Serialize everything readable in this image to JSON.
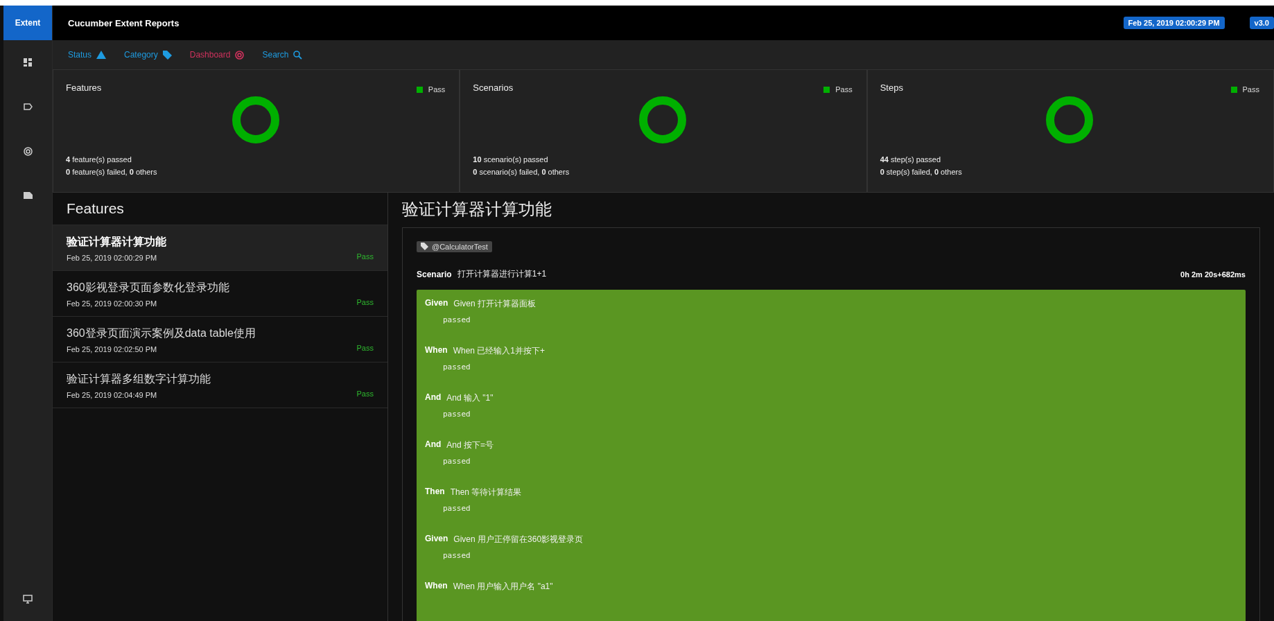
{
  "brand": "Extent",
  "header": {
    "title": "Cucumber Extent Reports",
    "date": "Feb 25, 2019 02:00:29 PM",
    "version": "v3.0"
  },
  "sidebar": {
    "items": [
      {
        "kind": "grid",
        "selected": false
      },
      {
        "kind": "tag",
        "selected": false
      },
      {
        "kind": "radial",
        "selected": false
      },
      {
        "kind": "card",
        "selected": false
      }
    ],
    "bottom": {
      "kind": "monitor"
    }
  },
  "nav": [
    {
      "label": "Status",
      "kind": "warning",
      "selected": false
    },
    {
      "label": "Category",
      "kind": "tag",
      "selected": false
    },
    {
      "label": "Dashboard",
      "kind": "radial",
      "selected": true
    },
    {
      "label": "Search",
      "kind": "search",
      "selected": false
    }
  ],
  "summary": [
    {
      "title": "Features",
      "legend": "Pass",
      "color": "#00b000",
      "passed_count": "4",
      "passed_text": "feature(s) passed",
      "failed_count": "0",
      "failed_text": "feature(s) failed,",
      "others_count": "0",
      "others_text": "others"
    },
    {
      "title": "Scenarios",
      "legend": "Pass",
      "color": "#00b000",
      "passed_count": "10",
      "passed_text": "scenario(s) passed",
      "failed_count": "0",
      "failed_text": "scenario(s) failed,",
      "others_count": "0",
      "others_text": "others"
    },
    {
      "title": "Steps",
      "legend": "Pass",
      "color": "#00b000",
      "passed_count": "44",
      "passed_text": "step(s) passed",
      "failed_count": "0",
      "failed_text": "step(s) failed,",
      "others_count": "0",
      "others_text": "others"
    }
  ],
  "features": {
    "heading": "Features",
    "items": [
      {
        "name": "验证计算器计算功能",
        "time": "Feb 25, 2019 02:00:29 PM",
        "status": "Pass",
        "selected": true
      },
      {
        "name": "360影视登录页面参数化登录功能",
        "time": "Feb 25, 2019 02:00:30 PM",
        "status": "Pass",
        "selected": false
      },
      {
        "name": "360登录页面演示案例及data table使用",
        "time": "Feb 25, 2019 02:02:50 PM",
        "status": "Pass",
        "selected": false
      },
      {
        "name": "验证计算器多组数字计算功能",
        "time": "Feb 25, 2019 02:04:49 PM",
        "status": "Pass",
        "selected": false
      }
    ]
  },
  "detail": {
    "title": "验证计算器计算功能",
    "tag": "@CalculatorTest",
    "scenario_label": "Scenario",
    "scenario_name": "打开计算器进行计算1+1",
    "duration": "0h 2m 20s+682ms",
    "steps": [
      {
        "keyword": "Given",
        "name": "Given 打开计算器面板",
        "status": "passed"
      },
      {
        "keyword": "When",
        "name": "When 已经输入1并按下+",
        "status": "passed"
      },
      {
        "keyword": "And",
        "name": "And 输入 \"1\"",
        "status": "passed"
      },
      {
        "keyword": "And",
        "name": "And 按下=号",
        "status": "passed"
      },
      {
        "keyword": "Then",
        "name": "Then 等待计算结果",
        "status": "passed"
      },
      {
        "keyword": "Given",
        "name": "Given 用户正停留在360影视登录页",
        "status": "passed"
      },
      {
        "keyword": "When",
        "name": "When 用户输入用户名 \"a1\""
      }
    ]
  }
}
